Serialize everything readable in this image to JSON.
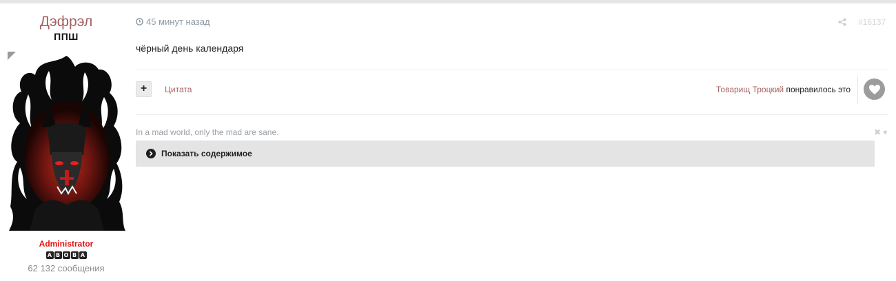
{
  "author": {
    "name": "Дэфрэл",
    "group": "ППШ",
    "role": "Administrator",
    "badges": [
      "A",
      "B",
      "O",
      "B",
      "A"
    ],
    "post_count": "62 132 сообщения",
    "avatar_icon": "demon-in-flames-avatar"
  },
  "post": {
    "time": "45 минут назад",
    "post_id": "#16137",
    "text": "чёрный день календаря"
  },
  "actions": {
    "plus_label": "+",
    "quote_label": "Цитата",
    "liker": "Товарищ Троцкий",
    "liked_text": " понравилось это"
  },
  "signature": {
    "text": "In a mad world, only the mad are sane.",
    "controls": "✖ ▾",
    "spoiler_label": "Показать содержимое"
  },
  "colors": {
    "accent": "#a66062",
    "role": "#e31111",
    "muted": "#8e9aa3"
  }
}
